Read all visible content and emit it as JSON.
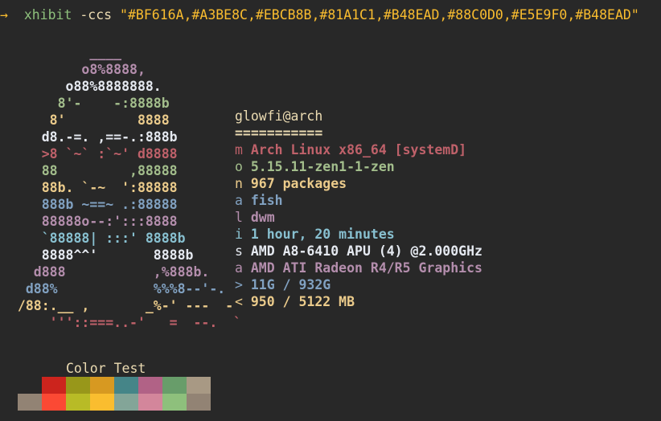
{
  "prompt": {
    "arrow": "→",
    "command": "xhibit",
    "flag": "-ccs",
    "argument": "\"#BF616A,#A3BE8C,#EBCB8B,#81A1C1,#B48EAD,#88C0D0,#E5E9F0,#B48EAD\""
  },
  "art": [
    {
      "text": "          ____",
      "color": "#B48EAD"
    },
    {
      "text": "         o8%8888,",
      "color": "#B48EAD"
    },
    {
      "text": "       o88%8888888.",
      "color": "#E5E9F0"
    },
    {
      "text": "      8'-    -:8888b",
      "color": "#A3BE8C"
    },
    {
      "text": "     8'         8888",
      "color": "#EBCB8B"
    },
    {
      "text": "    d8.-=. ,==-.:888b",
      "color": "#E5E9F0"
    },
    {
      "text": "    >8 `~` :`~' d8888",
      "color": "#BF616A"
    },
    {
      "text": "    88         ,88888",
      "color": "#A3BE8C"
    },
    {
      "text": "    88b. `-~  ':88888",
      "color": "#EBCB8B"
    },
    {
      "text": "    888b ~==~ .:88888",
      "color": "#81A1C1"
    },
    {
      "text": "    88888o--:':::8888",
      "color": "#B48EAD"
    },
    {
      "text": "    `88888| :::' 8888b",
      "color": "#88C0D0"
    },
    {
      "text": "    8888^^'       8888b",
      "color": "#E5E9F0"
    },
    {
      "text": "   d888           ,%888b.",
      "color": "#B48EAD"
    },
    {
      "text": "  d88%            %%%8--'-.",
      "color": "#81A1C1"
    },
    {
      "text": " /88:.__ ,       _%-' ---  -",
      "color": "#EBCB8B"
    },
    {
      "text": "     '''::===..-'   =  --.  `",
      "color": "#BF616A"
    }
  ],
  "info": {
    "userhost": "glowfi@arch",
    "separator": "===========",
    "rows": [
      {
        "key": "m",
        "value": "Arch Linux x86_64 [systemD]",
        "color": "#BF616A"
      },
      {
        "key": "o",
        "value": "5.15.11-zen1-1-zen",
        "color": "#A3BE8C"
      },
      {
        "key": "n",
        "value": "967 packages",
        "color": "#EBCB8B"
      },
      {
        "key": "a",
        "value": "fish",
        "color": "#81A1C1"
      },
      {
        "key": "l",
        "value": "dwm",
        "color": "#B48EAD"
      },
      {
        "key": "i",
        "value": "1 hour, 20 minutes",
        "color": "#88C0D0"
      },
      {
        "key": "s",
        "value": "AMD A8-6410 APU (4) @2.000GHz",
        "color": "#E5E9F0"
      },
      {
        "key": "a",
        "value": "AMD ATI Radeon R4/R5 Graphics",
        "color": "#B48EAD"
      },
      {
        "key": ">",
        "value": "11G / 932G",
        "color": "#81A1C1"
      },
      {
        "key": "<",
        "value": "950 / 5122 MB",
        "color": "#EBCB8B"
      }
    ]
  },
  "colortest": {
    "title": "Color Test",
    "row1": [
      "#282828",
      "#CC241D",
      "#98971A",
      "#D79921",
      "#458588",
      "#B16286",
      "#689D6A",
      "#A89984"
    ],
    "row2": [
      "#928374",
      "#FB4934",
      "#B8BB26",
      "#FABD2F",
      "#83A598",
      "#D3869B",
      "#8EC07C",
      "#928374"
    ]
  }
}
